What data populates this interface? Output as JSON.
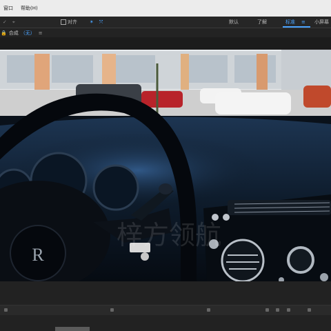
{
  "menu": {
    "items": [
      "窗口",
      "帮助(H)"
    ]
  },
  "toolbar": {
    "align_label": "对齐",
    "workspaces": [
      "默认",
      "了解",
      "标准",
      "小屏幕"
    ],
    "active_workspace": "标准"
  },
  "composition": {
    "name": "合成",
    "value": "（无）"
  },
  "watermark": "梓方领航",
  "colors": {
    "accent": "#4aa3ff",
    "menubar": "#ececec",
    "panel": "#262626"
  }
}
